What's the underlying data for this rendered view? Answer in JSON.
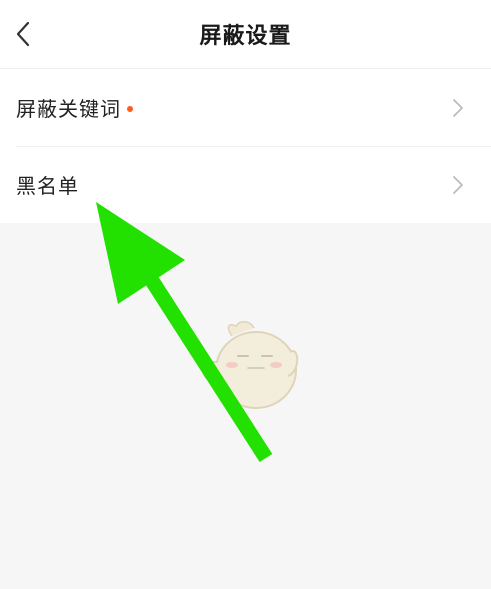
{
  "header": {
    "title": "屏蔽设置",
    "back_icon": "chevron-left-icon"
  },
  "settings": {
    "items": [
      {
        "label": "屏蔽关键词",
        "has_dot": true,
        "dot_color": "#ff5a1f",
        "icon": "chevron-right-icon"
      },
      {
        "label": "黑名单",
        "has_dot": false,
        "icon": "chevron-right-icon"
      }
    ]
  },
  "colors": {
    "background": "#f6f6f6",
    "surface": "#ffffff",
    "chevron": "#bbbbbb",
    "annotation_arrow": "#22e000"
  }
}
